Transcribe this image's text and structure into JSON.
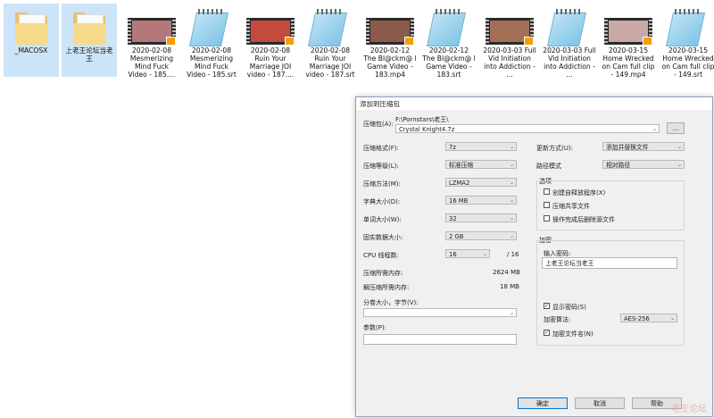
{
  "files": [
    {
      "name": "_MACOSX",
      "kind": "folder-empty",
      "selected": true
    },
    {
      "name": "上老王论坛当老王",
      "kind": "folder",
      "selected": true
    },
    {
      "name": "2020-02-08 Mesmerizing Mind Fuck Video - 185....",
      "kind": "video",
      "thumb": "#b5787a"
    },
    {
      "name": "2020-02-08 Mesmerizing Mind Fuck Video - 185.srt",
      "kind": "notepad"
    },
    {
      "name": "2020-02-08 Ruin Your Marriage JOI video - 187....",
      "kind": "video",
      "thumb": "#c54a3e"
    },
    {
      "name": "2020-02-08 Ruin Your Marriage JOI video - 187.srt",
      "kind": "notepad"
    },
    {
      "name": "2020-02-12 The Bl@ckm@ l Game  Video - 183.mp4",
      "kind": "video",
      "thumb": "#8c5a4a"
    },
    {
      "name": "2020-02-12 The Bl@ckm@ l Game  Video - 183.srt",
      "kind": "notepad"
    },
    {
      "name": "2020-03-03 Full Vid Initiation into Addiction - ...",
      "kind": "video",
      "thumb": "#a37056"
    },
    {
      "name": "2020-03-03 Full Vid Initiation into Addiction - ...",
      "kind": "notepad"
    },
    {
      "name": "2020-03-15 Home Wrecked on Cam  full clip - 149.mp4",
      "kind": "video",
      "thumb": "#c9a8a6"
    },
    {
      "name": "2020-03-15 Home Wrecked on Cam  full clip - 149.srt",
      "kind": "notepad"
    }
  ],
  "dialog": {
    "title": "添加到压缩包",
    "archive_label": "压缩包(A):",
    "archive_path": "F:\\Pornstars\\老王\\",
    "archive_name": "Crystal Knight4.7z",
    "browse": "...",
    "left": {
      "format_label": "压缩格式(F):",
      "format_value": "7z",
      "level_label": "压缩等级(L):",
      "level_value": "标准压缩",
      "method_label": "压缩方法(M):",
      "method_value": "LZMA2",
      "dict_label": "字典大小(D):",
      "dict_value": "16 MB",
      "word_label": "单词大小(W):",
      "word_value": "32",
      "solid_label": "固实数据大小:",
      "solid_value": "2 GB",
      "threads_label": "CPU 线程数:",
      "threads_value": "16",
      "threads_total": "/ 16",
      "mem_comp_label": "压缩所需内存:",
      "mem_comp_value": "2624 MB",
      "mem_decomp_label": "解压缩所需内存:",
      "mem_decomp_value": "18 MB",
      "split_label": "分卷大小，字节(V):",
      "split_value": "",
      "params_label": "参数(P):",
      "params_value": ""
    },
    "right": {
      "update_label": "更新方式(U):",
      "update_value": "添加并替换文件",
      "pathmode_label": "路径模式",
      "pathmode_value": "相对路径",
      "options_title": "选项",
      "opt_sfx": "创建自释放程序(X)",
      "opt_shared": "压缩共享文件",
      "opt_delete": "操作完成后删除源文件",
      "enc_title": "加密",
      "pwd_label": "输入密码:",
      "pwd_value": "上老王论坛当老王",
      "show_pwd": "显示密码(S)",
      "enc_method_label": "加密算法:",
      "enc_method_value": "AES-256",
      "enc_names": "加密文件名(N)"
    },
    "buttons": {
      "ok": "确定",
      "cancel": "取消",
      "help": "帮助"
    }
  },
  "watermark": "老王论坛",
  "colors": {
    "selection": "#cce4f7",
    "dialog_bg": "#f0f0f0",
    "accent": "#0078d7"
  }
}
